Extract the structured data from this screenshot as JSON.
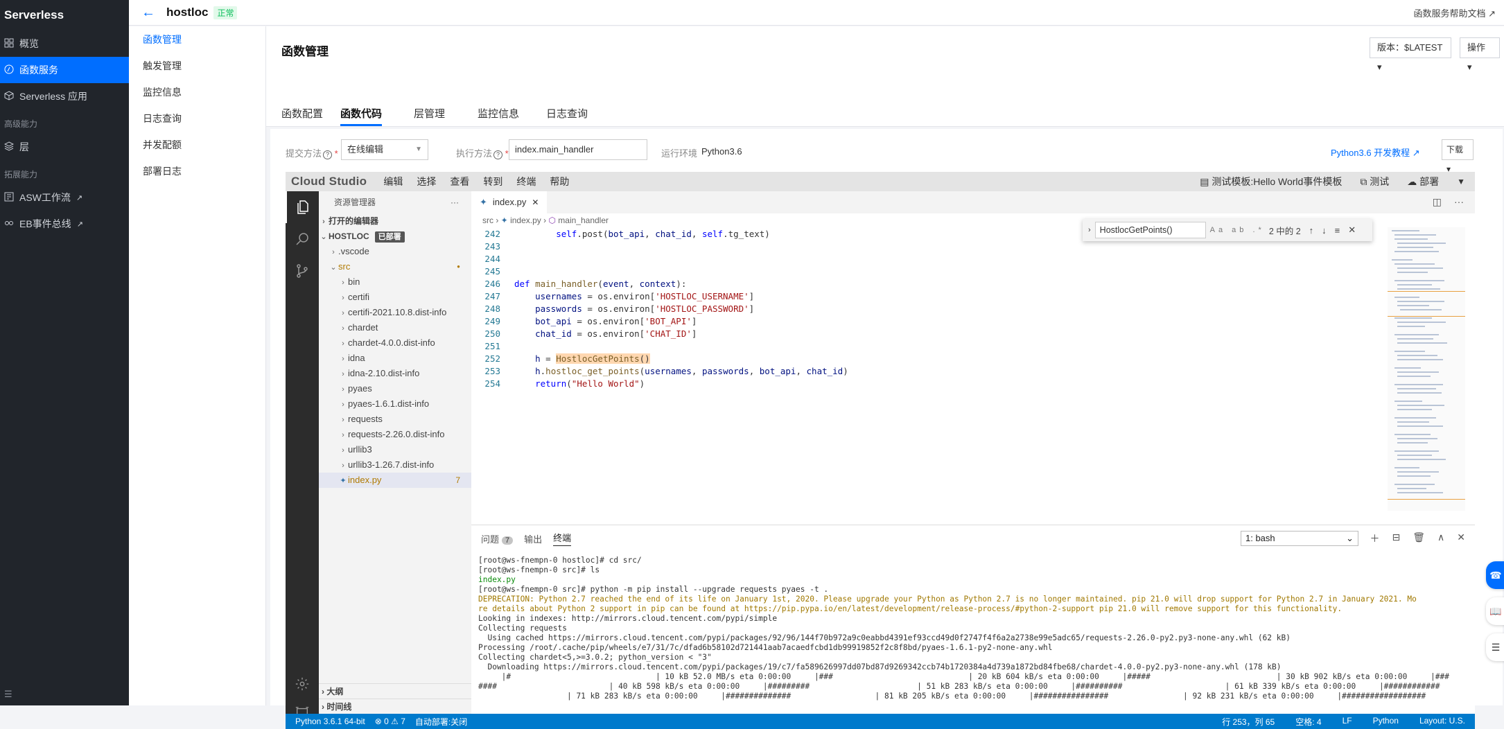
{
  "app": {
    "brand": "Serverless",
    "nav": [
      {
        "label": "概览",
        "icon": "grid-icon"
      },
      {
        "label": "函数服务",
        "icon": "function-icon",
        "active": true
      },
      {
        "label": "Serverless 应用",
        "icon": "cube-icon"
      }
    ],
    "section_advanced": "高级能力",
    "nav_advanced": [
      {
        "label": "层",
        "icon": "layers-icon"
      }
    ],
    "section_extend": "拓展能力",
    "nav_extend": [
      {
        "label": "ASW工作流",
        "icon": "workflow-icon"
      },
      {
        "label": "EB事件总线",
        "icon": "eventbus-icon"
      }
    ],
    "external_mark": "↗",
    "collapse_icon": "☰"
  },
  "topbar": {
    "function_name": "hostloc",
    "status": "正常",
    "help_link": "函数服务帮助文档 ↗"
  },
  "subnav": [
    "函数管理",
    "触发管理",
    "监控信息",
    "日志查询",
    "并发配额",
    "部署日志"
  ],
  "page": {
    "title": "函数管理",
    "version_button": "版本：$LATEST ▾",
    "ops_button": "操作 ▾",
    "tabs": [
      "函数配置",
      "函数代码",
      "层管理",
      "监控信息",
      "日志查询"
    ],
    "active_tab": "函数代码"
  },
  "form": {
    "submit_label": "提交方法",
    "submit_value": "在线编辑",
    "handler_label": "执行方法",
    "handler_value": "index.main_handler",
    "runtime_label": "运行环境",
    "runtime_value": "Python3.6",
    "tutorial_link": "Python3.6 开发教程 ↗",
    "download_button": "下载 ▾",
    "required_mark": "*",
    "help_mark": "?"
  },
  "ide": {
    "logo": "Cloud Studio",
    "menu": [
      "编辑",
      "选择",
      "查看",
      "转到",
      "终端",
      "帮助"
    ],
    "test_template": "测试模板:Hello World事件模板",
    "test_button": "测试",
    "deploy_button": "部署",
    "explorer": {
      "title": "资源管理器",
      "more": "···",
      "open_editors": "打开的编辑器",
      "root": "HOSTLOC",
      "deployed_tag": "已部署",
      "items": [
        {
          "name": ".vscode",
          "indent": 1,
          "twisty": "›"
        },
        {
          "name": "src",
          "indent": 1,
          "twisty": "⌄",
          "modified": "●"
        },
        {
          "name": "bin",
          "indent": 2,
          "twisty": "›"
        },
        {
          "name": "certifi",
          "indent": 2,
          "twisty": "›"
        },
        {
          "name": "certifi-2021.10.8.dist-info",
          "indent": 2,
          "twisty": "›"
        },
        {
          "name": "chardet",
          "indent": 2,
          "twisty": "›"
        },
        {
          "name": "chardet-4.0.0.dist-info",
          "indent": 2,
          "twisty": "›"
        },
        {
          "name": "idna",
          "indent": 2,
          "twisty": "›"
        },
        {
          "name": "idna-2.10.dist-info",
          "indent": 2,
          "twisty": "›"
        },
        {
          "name": "pyaes",
          "indent": 2,
          "twisty": "›"
        },
        {
          "name": "pyaes-1.6.1.dist-info",
          "indent": 2,
          "twisty": "›"
        },
        {
          "name": "requests",
          "indent": 2,
          "twisty": "›"
        },
        {
          "name": "requests-2.26.0.dist-info",
          "indent": 2,
          "twisty": "›"
        },
        {
          "name": "urllib3",
          "indent": 2,
          "twisty": "›"
        },
        {
          "name": "urllib3-1.26.7.dist-info",
          "indent": 2,
          "twisty": "›"
        },
        {
          "name": "index.py",
          "indent": 2,
          "twisty": "",
          "count": "7",
          "selected": true
        }
      ],
      "outline": "大纲",
      "timeline": "时间线"
    },
    "editor": {
      "tab": "index.py",
      "breadcrumb": [
        "src",
        "index.py",
        "main_handler"
      ],
      "lines": [
        {
          "n": "242",
          "html": "        <span class=\"slf\">self</span>.post(<span class=\"var\">bot_api</span>, <span class=\"var\">chat_id</span>, <span class=\"slf\">self</span>.tg_text)"
        },
        {
          "n": "243",
          "html": ""
        },
        {
          "n": "244",
          "html": ""
        },
        {
          "n": "245",
          "html": ""
        },
        {
          "n": "246",
          "html": "<span class=\"kw\">def</span> <span class=\"fn\">main_handler</span>(<span class=\"var\">event</span>, <span class=\"var\">context</span>):"
        },
        {
          "n": "247",
          "html": "    <span class=\"var\">usernames</span> = os.environ[<span class=\"str\">'HOSTLOC_USERNAME'</span>]"
        },
        {
          "n": "248",
          "html": "    <span class=\"var\">passwords</span> = os.environ[<span class=\"str\">'HOSTLOC_PASSWORD'</span>]"
        },
        {
          "n": "249",
          "html": "    <span class=\"var\">bot_api</span> = os.environ[<span class=\"str\">'BOT_API'</span>]"
        },
        {
          "n": "250",
          "html": "    <span class=\"var\">chat_id</span> = os.environ[<span class=\"str\">'CHAT_ID'</span>]"
        },
        {
          "n": "251",
          "html": ""
        },
        {
          "n": "252",
          "html": "    <span class=\"var\">h</span> = <span class=\"hl\"><span class=\"fn\">HostlocGetPoints</span>()</span>"
        },
        {
          "n": "253",
          "html": "    <span class=\"var\">h</span>.<span class=\"fn\">hostloc_get_points</span>(<span class=\"var\">usernames</span>, <span class=\"var\">passwords</span>, <span class=\"var\">bot_api</span>, <span class=\"var\">chat_id</span>)"
        },
        {
          "n": "254",
          "html": "    <span class=\"kw\">return</span>(<span class=\"str\">\"Hello World\"</span>)"
        }
      ],
      "find": {
        "query": "HostlocGetPoints()",
        "options": "Aa ab .*",
        "result": "2 中的 2",
        "controls": [
          "↑",
          "↓",
          "≡",
          "✕"
        ]
      }
    },
    "panel": {
      "tabs": [
        "问题",
        "输出",
        "终端"
      ],
      "problems_count": "7",
      "active": "终端",
      "shell": "1: bash",
      "shell_arrow": "⌄",
      "actions": [
        "＋",
        "⊟",
        "🗑",
        "∧",
        "✕"
      ],
      "terminal_lines": [
        {
          "t": "[root@ws-fnempn-0 hostloc]# cd src/",
          "c": ""
        },
        {
          "t": "[root@ws-fnempn-0 src]# ls",
          "c": ""
        },
        {
          "t": "index.py",
          "c": "g"
        },
        {
          "t": "[root@ws-fnempn-0 src]# python -m pip install --upgrade requests pyaes -t .",
          "c": ""
        },
        {
          "t": "DEPRECATION: Python 2.7 reached the end of its life on January 1st, 2020. Please upgrade your Python as Python 2.7 is no longer maintained. pip 21.0 will drop support for Python 2.7 in January 2021. Mo",
          "c": "y"
        },
        {
          "t": "re details about Python 2 support in pip can be found at https://pip.pypa.io/en/latest/development/release-process/#python-2-support pip 21.0 will remove support for this functionality.",
          "c": "y"
        },
        {
          "t": "Looking in indexes: http://mirrors.cloud.tencent.com/pypi/simple",
          "c": ""
        },
        {
          "t": "Collecting requests",
          "c": ""
        },
        {
          "t": "  Using cached https://mirrors.cloud.tencent.com/pypi/packages/92/96/144f70b972a9c0eabbd4391ef93ccd49d0f2747f4f6a2a2738e99e5adc65/requests-2.26.0-py2.py3-none-any.whl (62 kB)",
          "c": ""
        },
        {
          "t": "Processing /root/.cache/pip/wheels/e7/31/7c/dfad6b58102d721441aab7acaedfcbd1db99919852f2c8f8bd/pyaes-1.6.1-py2-none-any.whl",
          "c": ""
        },
        {
          "t": "Collecting chardet<5,>=3.0.2; python_version < \"3\"",
          "c": ""
        },
        {
          "t": "  Downloading https://mirrors.cloud.tencent.com/pypi/packages/19/c7/fa589626997dd07bd87d9269342ccb74b1720384a4d739a1872bd84fbe68/chardet-4.0.0-py2.py3-none-any.whl (178 kB)",
          "c": ""
        },
        {
          "t": "     |#                               | 10 kB 52.0 MB/s eta 0:00:00     |###                             | 20 kB 604 kB/s eta 0:00:00     |#####                           | 30 kB 902 kB/s eta 0:00:00     |###",
          "c": ""
        },
        {
          "t": "####                        | 40 kB 598 kB/s eta 0:00:00     |#########                       | 51 kB 283 kB/s eta 0:00:00     |##########                      | 61 kB 339 kB/s eta 0:00:00     |############",
          "c": ""
        },
        {
          "t": "                   | 71 kB 283 kB/s eta 0:00:00     |##############                  | 81 kB 205 kB/s eta 0:00:00     |################                | 92 kB 231 kB/s eta 0:00:00     |##################",
          "c": ""
        }
      ]
    },
    "status": {
      "python": "Python 3.6.1 64-bit",
      "problems": "⊗ 0 ⚠ 7",
      "auto_deploy": "自动部署:关闭",
      "position": "行 253，列 65",
      "spaces": "空格: 4",
      "eol": "LF",
      "lang": "Python",
      "layout": "Layout: U.S."
    }
  },
  "colors": {
    "accent": "#006eff",
    "sidebar_bg": "#21252b",
    "status_bar": "#007acc"
  }
}
